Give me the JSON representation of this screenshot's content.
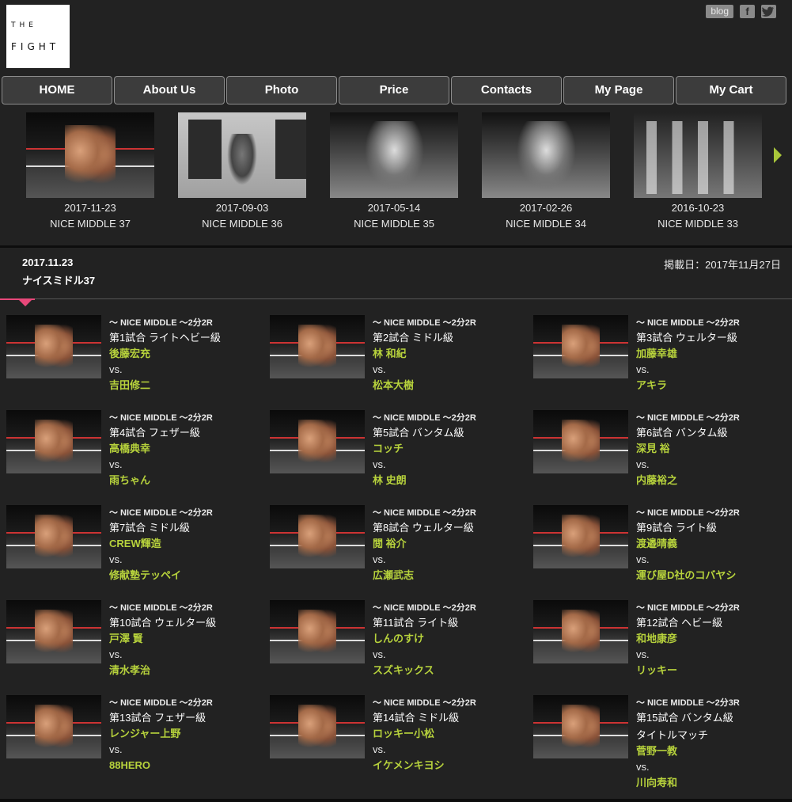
{
  "header": {
    "logo_line1": "THE",
    "logo_line2": "FIGHT",
    "blog_label": "blog",
    "facebook_glyph": "f",
    "twitter_glyph": "t"
  },
  "nav": [
    "HOME",
    "About Us",
    "Photo",
    "Price",
    "Contacts",
    "My Page",
    "My Cart"
  ],
  "events": [
    {
      "date": "2017-11-23",
      "name": "NICE MIDDLE 37",
      "photo": "ring"
    },
    {
      "date": "2017-09-03",
      "name": "NICE MIDDLE 36",
      "photo": "poster"
    },
    {
      "date": "2017-05-14",
      "name": "NICE MIDDLE 35",
      "photo": "bw"
    },
    {
      "date": "2017-02-26",
      "name": "NICE MIDDLE 34",
      "photo": "bw"
    },
    {
      "date": "2016-10-23",
      "name": "NICE MIDDLE 33",
      "photo": "girls"
    }
  ],
  "event_detail": {
    "date": "2017.11.23",
    "title": "ナイスミドル37",
    "posted": "掲載日：2017年11月27日"
  },
  "matches": [
    {
      "series": "～ NICE MIDDLE ～2分2R",
      "bout": "第1試合 ライトヘビー級",
      "f1": "後藤宏充",
      "vs": "vs.",
      "f2": "吉田修二"
    },
    {
      "series": "～ NICE MIDDLE ～2分2R",
      "bout": "第2試合 ミドル級",
      "f1": "林 和紀",
      "vs": "vs.",
      "f2": "松本大樹"
    },
    {
      "series": "～ NICE MIDDLE ～2分2R",
      "bout": "第3試合 ウェルター級",
      "f1": "加藤幸雄",
      "vs": "vs.",
      "f2": "アキラ"
    },
    {
      "series": "～ NICE MIDDLE ～2分2R",
      "bout": "第4試合 フェザー級",
      "f1": "高橋典幸",
      "vs": "vs.",
      "f2": "雨ちゃん"
    },
    {
      "series": "～ NICE MIDDLE ～2分2R",
      "bout": "第5試合 バンタム級",
      "f1": "コッチ",
      "vs": "vs.",
      "f2": "林 史朗"
    },
    {
      "series": "～ NICE MIDDLE ～2分2R",
      "bout": "第6試合 バンタム級",
      "f1": "深見 裕",
      "vs": "vs.",
      "f2": "内藤裕之"
    },
    {
      "series": "～ NICE MIDDLE ～2分2R",
      "bout": "第7試合 ミドル級",
      "f1": "CREW輝造",
      "vs": "vs.",
      "f2": "修献塾テッペイ"
    },
    {
      "series": "～ NICE MIDDLE ～2分2R",
      "bout": "第8試合 ウェルター級",
      "f1": "閲 裕介",
      "vs": "vs.",
      "f2": "広瀬武志"
    },
    {
      "series": "～ NICE MIDDLE ～2分2R",
      "bout": "第9試合 ライト級",
      "f1": "渡邉晴義",
      "vs": "vs.",
      "f2": "運び屋D社のコバヤシ"
    },
    {
      "series": "～ NICE MIDDLE ～2分2R",
      "bout": "第10試合 ウェルター級",
      "f1": "戸澤 賢",
      "vs": "vs.",
      "f2": "清水孝治"
    },
    {
      "series": "～ NICE MIDDLE ～2分2R",
      "bout": "第11試合 ライト級",
      "f1": "しんのすけ",
      "vs": "vs.",
      "f2": "スズキックス"
    },
    {
      "series": "～ NICE MIDDLE ～2分2R",
      "bout": "第12試合 ヘビー級",
      "f1": "和地康彦",
      "vs": "vs.",
      "f2": "リッキー"
    },
    {
      "series": "～ NICE MIDDLE ～2分2R",
      "bout": "第13試合 フェザー級",
      "f1": "レンジャー上野",
      "vs": "vs.",
      "f2": "88HERO"
    },
    {
      "series": "～ NICE MIDDLE ～2分2R",
      "bout": "第14試合 ミドル級",
      "f1": "ロッキー小松",
      "vs": "vs.",
      "f2": "イケメンキヨシ"
    },
    {
      "series": "～ NICE MIDDLE ～2分3R",
      "bout": "第15試合 バンタム級",
      "title": "タイトルマッチ",
      "f1": "菅野一教",
      "vs": "vs.",
      "f2": "川向寿和"
    }
  ],
  "colors": {
    "background": "#222222",
    "fighter_name": "#b7d23c",
    "accent": "#e8487a",
    "next_arrow": "#a8c63a"
  },
  "icons": {
    "next": "chevron-right-icon",
    "facebook": "facebook-icon",
    "twitter": "twitter-icon"
  }
}
